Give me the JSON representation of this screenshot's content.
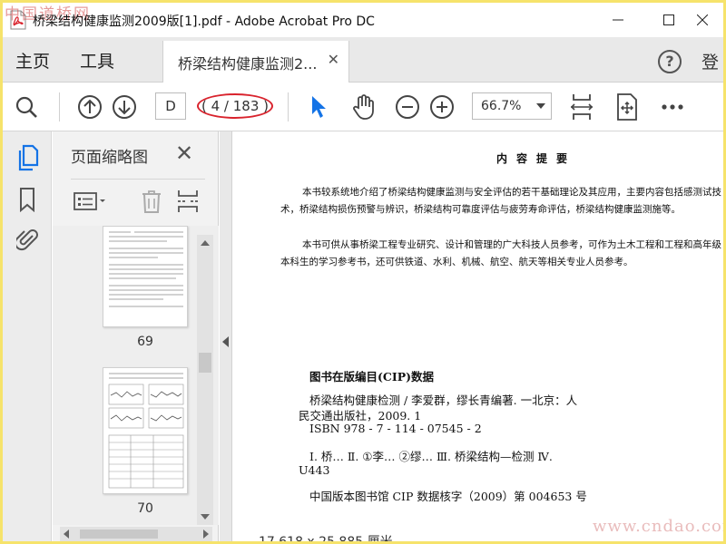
{
  "window": {
    "title": "桥梁结构健康监测2009版[1].pdf - Adobe Acrobat Pro DC",
    "watermark_top": "中国道桥网"
  },
  "tabs": {
    "home": "主页",
    "tools": "工具",
    "document_tab": "桥梁结构健康监测2...",
    "help": "?",
    "login": "登"
  },
  "toolbar": {
    "page_input": "D",
    "page_count": "( 4 / 183 )",
    "zoom": "66.7%"
  },
  "sidebar": {
    "panel_title": "页面缩略图",
    "thumbnails": [
      {
        "page": "69"
      },
      {
        "page": "70"
      }
    ]
  },
  "document": {
    "heading": "内容提要",
    "paragraph1": "本书较系统地介绍了桥梁结构健康监测与安全评估的若干基础理论及其应用，主要内容包括感测试技术，桥梁结构损伤预警与辨识，桥梁结构可靠度评估与疲劳寿命评估，桥梁结构健康监测施等。",
    "paragraph2": "本书可供从事桥梁工程专业研究、设计和管理的广大科技人员参考，可作为土木工程和工程和高年级本科生的学习参考书，还可供铁道、水利、机械、航空、航天等相关专业人员参考。",
    "cip_title": "图书在版编目(CIP)数据",
    "cip_line1": "桥梁结构健康检测 / 李爱群，缪长青编著. 一北京：人",
    "cip_line2": "民交通出版社，2009. 1",
    "cip_line3": "ISBN 978 - 7 - 114 - 07545 - 2",
    "cip_line4": "Ⅰ. 桥…  Ⅱ. ①李…  ②缪…  Ⅲ. 桥梁结构—检测  Ⅳ.",
    "cip_line5": "U443",
    "cip_line6": "中国版本图书馆 CIP 数据核字（2009）第 004653 号",
    "page_size": "17.618 x 25.885 厘米",
    "watermark_bottom": "www.cndao.com"
  },
  "colors": {
    "accent_blue": "#1473e6",
    "highlight_red": "#d9232d",
    "frame_yellow": "#f6e36b"
  },
  "icons": [
    "acrobat-icon",
    "minimize-icon",
    "maximize-icon",
    "close-icon",
    "search-icon",
    "prev-page-icon",
    "next-page-icon",
    "select-cursor-icon",
    "hand-tool-icon",
    "zoom-out-icon",
    "zoom-in-icon",
    "fit-page-icon",
    "scroll-mode-icon",
    "more-icon",
    "pages-icon",
    "bookmark-icon",
    "attachment-icon",
    "options-icon",
    "delete-icon",
    "insert-page-icon"
  ]
}
